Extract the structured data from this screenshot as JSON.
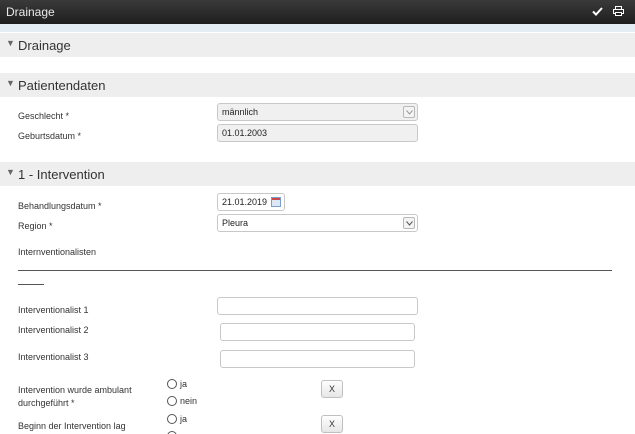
{
  "window": {
    "title": "Drainage",
    "confirm_icon": "check-icon",
    "print_icon": "print-icon"
  },
  "sections": [
    {
      "label": "Drainage",
      "icon": "chevron-down-icon"
    },
    {
      "label": "Patientendaten",
      "icon": "chevron-down-icon"
    },
    {
      "label": "1 - Intervention",
      "icon": "chevron-down-icon"
    }
  ],
  "patient": {
    "geschlecht_label": "Geschlecht *",
    "geschlecht_value": "männlich",
    "geburtsdatum_label": "Geburtsdatum *",
    "geburtsdatum_value": "01.01.2003"
  },
  "intervention": {
    "behandlungsdatum_label": "Behandlungsdatum *",
    "behandlungsdatum_value": "21.01.2019",
    "region_label": "Region *",
    "region_value": "Pleura",
    "interventionalisten_label": "Internventionalisten",
    "interventionalist1_label": "Interventionalist 1",
    "interventionalist2_label": "Interventionalist 2",
    "interventionalist3_label": "Interventionalist 3",
    "ambulant_label_line1": "Intervention wurde ambulant",
    "ambulant_label_line2": "durchgeführt *",
    "ja": "ja",
    "nein": "nein",
    "clear": "X",
    "beginn_label": "Beginn der Intervention lag"
  }
}
